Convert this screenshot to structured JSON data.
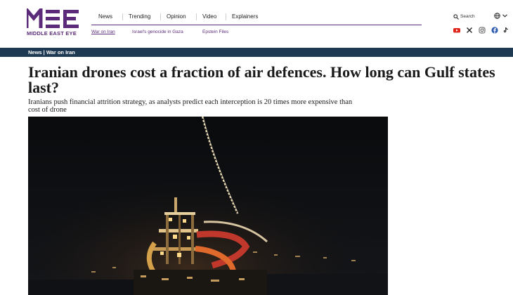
{
  "brand": {
    "logo_text": "MIDDLE EAST EYE",
    "colors": {
      "brand": "#5b2b7a",
      "section_bar": "#1e3a52"
    }
  },
  "nav": {
    "main": [
      {
        "label": "News"
      },
      {
        "label": "Trending"
      },
      {
        "label": "Opinion"
      },
      {
        "label": "Video"
      },
      {
        "label": "Explainers"
      }
    ],
    "sub": [
      {
        "label": "War on Iran"
      },
      {
        "label": "Israel's genocide in Gaza"
      },
      {
        "label": "Epstein Files"
      }
    ],
    "search_label": "Search",
    "icons": [
      "search-icon",
      "globe-icon",
      "chevron-down-icon",
      "youtube-icon",
      "x-icon",
      "instagram-icon",
      "facebook-icon",
      "tiktok-icon"
    ]
  },
  "section": {
    "label": "News | War on Iran"
  },
  "article": {
    "headline": "Iranian drones cost a fraction of air defences. How long can Gulf states last?",
    "standfirst": "Iranians push financial attrition strategy, as analysts predict each interception is 20 times more expensive than cost of drone"
  }
}
